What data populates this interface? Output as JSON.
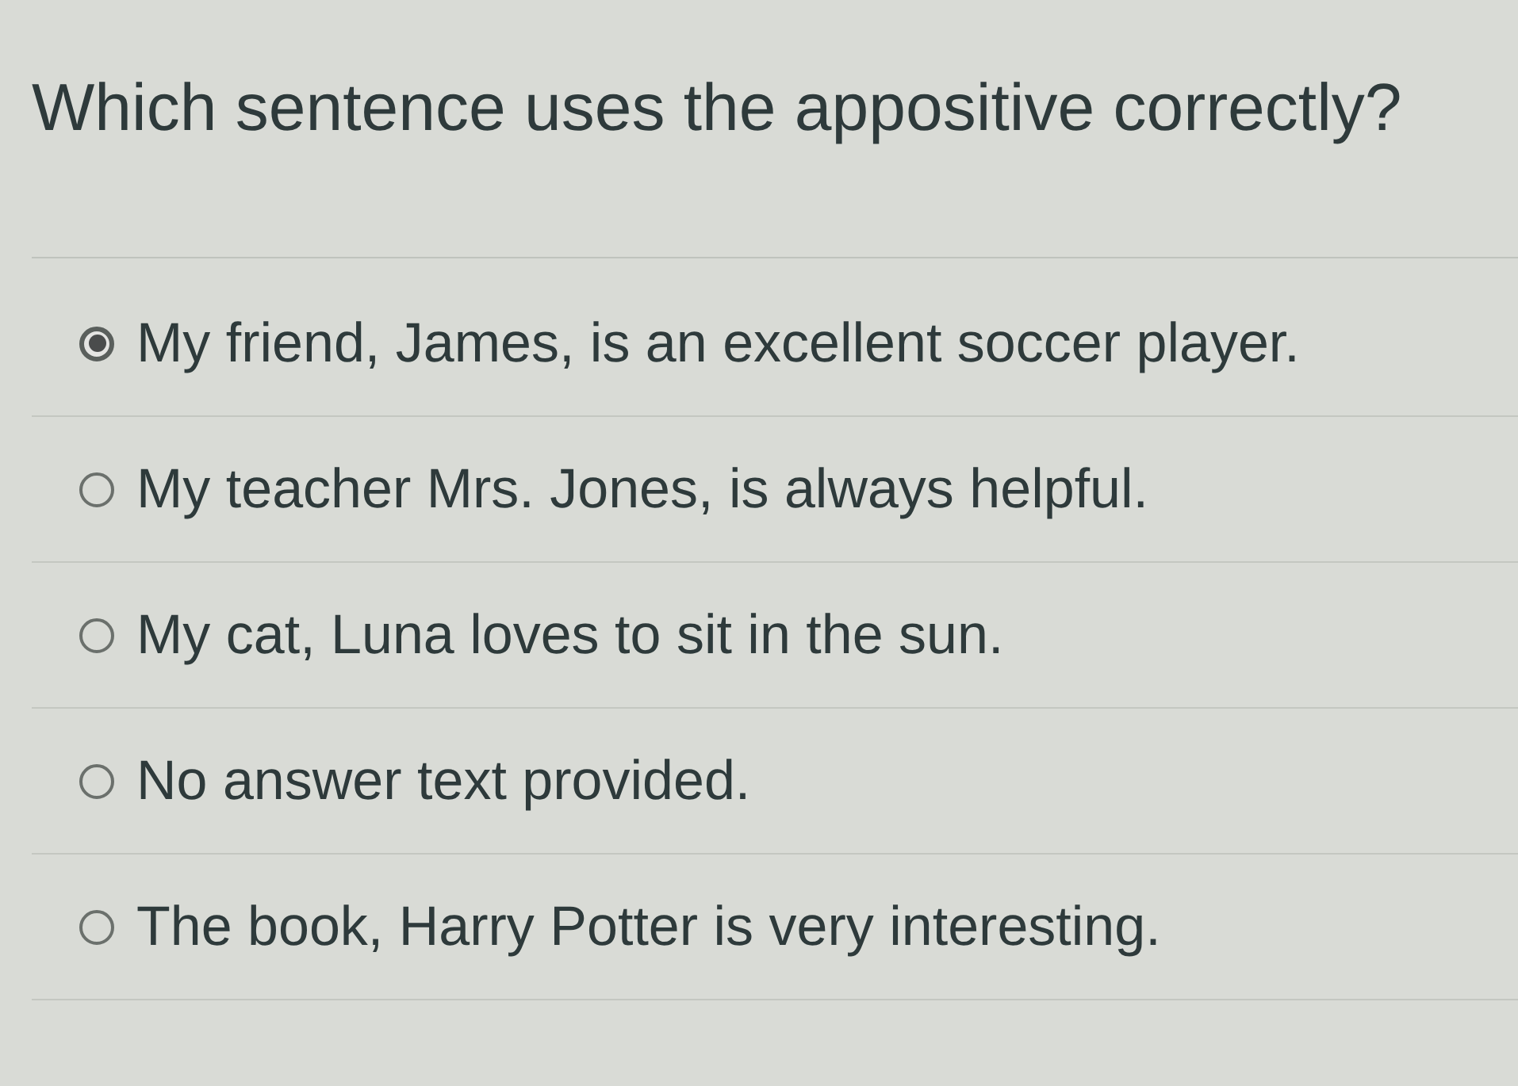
{
  "question": "Which sentence uses the appositive correctly?",
  "options": [
    {
      "label": "My friend, James, is an excellent soccer player.",
      "selected": true
    },
    {
      "label": "My teacher Mrs. Jones, is always helpful.",
      "selected": false
    },
    {
      "label": "My cat, Luna loves to sit in the sun.",
      "selected": false
    },
    {
      "label": "No answer text provided.",
      "selected": false
    },
    {
      "label": "The book, Harry Potter is very interesting.",
      "selected": false
    }
  ]
}
